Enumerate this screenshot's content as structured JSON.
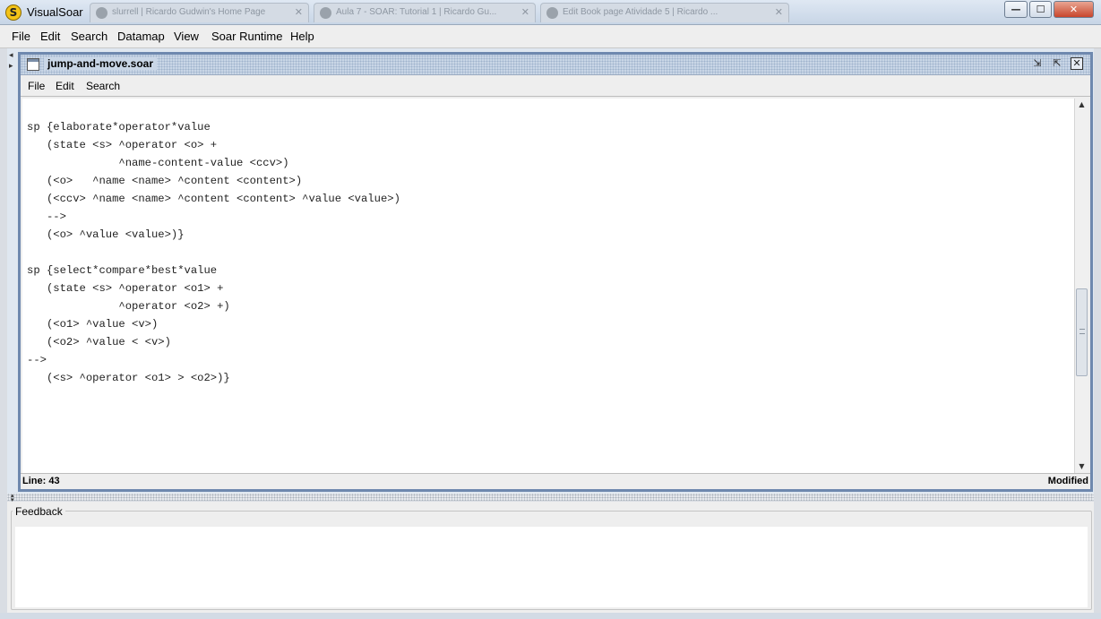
{
  "window": {
    "title": "VisualSoar",
    "background_tabs": [
      "slurrell | Ricardo Gudwin's Home Page",
      "Aula 7 - SOAR: Tutorial 1 | Ricardo Gu...",
      "Edit Book page Atividade 5 | Ricardo ..."
    ],
    "controls": {
      "minimize": "—",
      "maximize": "☐",
      "close": "✕"
    }
  },
  "menubar": {
    "items": [
      "File",
      "Edit",
      "Search",
      "Datamap",
      "View",
      "Soar Runtime",
      "Help"
    ]
  },
  "editor_frame": {
    "title": "jump-and-move.soar",
    "menu": [
      "File",
      "Edit",
      "Search"
    ],
    "code_lines": [
      "",
      "sp {elaborate*operator*value",
      "   (state <s> ^operator <o> +",
      "              ^name-content-value <ccv>)",
      "   (<o>   ^name <name> ^content <content>)",
      "   (<ccv> ^name <name> ^content <content> ^value <value>)",
      "   -->",
      "   (<o> ^value <value>)}",
      "",
      "sp {select*compare*best*value",
      "   (state <s> ^operator <o1> +",
      "              ^operator <o2> +)",
      "   (<o1> ^value <v>)",
      "   (<o2> ^value < <v>)",
      "-->",
      "   (<s> ^operator <o1> > <o2>)}"
    ],
    "status_line": "Line: 43",
    "status_modified": "Modified"
  },
  "feedback": {
    "title": "Feedback"
  },
  "colors": {
    "frame_border": "#6e88ae",
    "title_pattern": "#c9d6e6"
  }
}
